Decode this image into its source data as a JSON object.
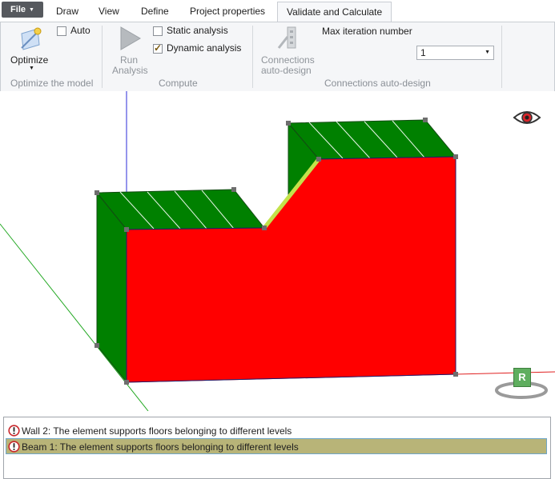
{
  "tabs": {
    "file_label": "File",
    "items": [
      {
        "label": "Draw"
      },
      {
        "label": "View"
      },
      {
        "label": "Define"
      },
      {
        "label": "Project properties"
      },
      {
        "label": "Validate and Calculate"
      }
    ],
    "active": "Validate and Calculate"
  },
  "ribbon": {
    "optimize": {
      "button_label": "Optimize",
      "auto_label": "Auto",
      "auto_checked": false,
      "group_label": "Optimize the model"
    },
    "compute": {
      "run_label_1": "Run",
      "run_label_2": "Analysis",
      "static_label": "Static analysis",
      "static_checked": false,
      "dynamic_label": "Dynamic analysis",
      "dynamic_checked": true,
      "group_label": "Compute"
    },
    "connections": {
      "button_label_1": "Connections",
      "button_label_2": "auto-design",
      "max_iter_label": "Max iteration number",
      "max_iter_value": "1",
      "group_label": "Connections auto-design"
    }
  },
  "viewport": {
    "wall_color": "#ff0000",
    "side_color": "#008000",
    "highlight_color": "#c3e24a",
    "cube_label": "R"
  },
  "messages": [
    {
      "text": "Wall 2: The element supports floors  belonging to different levels",
      "selected": false
    },
    {
      "text": "Beam 1: The element supports floors  belonging to different levels",
      "selected": true
    }
  ]
}
